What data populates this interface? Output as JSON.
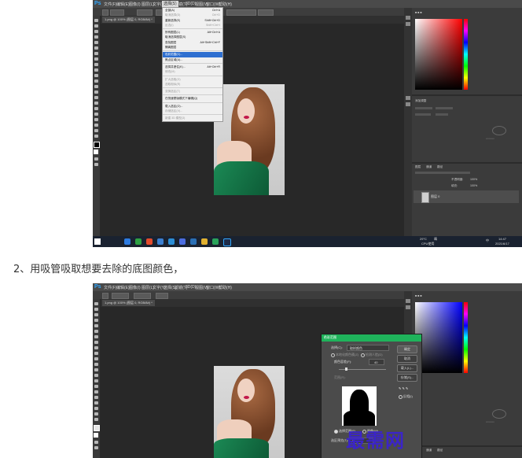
{
  "screenshot1": {
    "menu": [
      "文件(F)",
      "编辑(E)",
      "图像(I)",
      "图层(L)",
      "文字(Y)",
      "选择(S)",
      "滤镜(T)",
      "3D(D)",
      "视图(V)",
      "窗口(W)",
      "帮助(H)"
    ],
    "active_menu": "选择(S)",
    "doc_tab": "1.png @ 100% (图层 0, RGB/8#) *",
    "select_menu": [
      {
        "label": "全部(A)",
        "key": "Ctrl+A",
        "dim": false
      },
      {
        "label": "取消选择(D)",
        "key": "Ctrl+D",
        "dim": true
      },
      {
        "label": "重新选择(E)",
        "key": "Shift+Ctrl+D",
        "dim": false
      },
      {
        "label": "反选(I)",
        "key": "Shift+Ctrl+I",
        "dim": true
      },
      {
        "sep": true
      },
      {
        "label": "所有图层(L)",
        "key": "Alt+Ctrl+A",
        "dim": false
      },
      {
        "label": "取消选择图层(S)",
        "key": "",
        "dim": false
      },
      {
        "label": "查找图层",
        "key": "Alt+Shift+Ctrl+F",
        "dim": false
      },
      {
        "label": "隔离图层",
        "key": "",
        "dim": false
      },
      {
        "sep": true
      },
      {
        "label": "色彩范围(C)...",
        "key": "",
        "dim": false,
        "highlight": true
      },
      {
        "label": "焦点区域(U)...",
        "key": "",
        "dim": false
      },
      {
        "sep": true
      },
      {
        "label": "选择并遮住(K)...",
        "key": "Alt+Ctrl+R",
        "dim": false
      },
      {
        "label": "修改(M)",
        "key": "",
        "dim": true
      },
      {
        "sep": true
      },
      {
        "label": "扩大选取(G)",
        "key": "",
        "dim": true
      },
      {
        "label": "选取相似(R)",
        "key": "",
        "dim": true
      },
      {
        "sep": true
      },
      {
        "label": "变换选区(T)",
        "key": "",
        "dim": true
      },
      {
        "sep": true
      },
      {
        "label": "在快速蒙版模式下编辑(Q)",
        "key": "",
        "dim": false
      },
      {
        "sep": true
      },
      {
        "label": "载入选区(O)...",
        "key": "",
        "dim": false
      },
      {
        "label": "存储选区(V)...",
        "key": "",
        "dim": true
      },
      {
        "sep": true
      },
      {
        "label": "新建 3D 模型(3)",
        "key": "",
        "dim": true
      }
    ],
    "layers_tabs": [
      "图层",
      "通道",
      "路径"
    ],
    "layer_name": "图层 0",
    "panel_label": "添加调整",
    "opacity_label": "不透明度:",
    "opacity": "100%",
    "fill_label": "填充:",
    "fill": "100%",
    "taskbar_time": "14:47",
    "taskbar_date": "2021/6/17",
    "taskbar_temp": "29°C",
    "taskbar_cpu": "CPU使用",
    "taskbar_lang": "中",
    "taskbar_weather": "晴"
  },
  "caption": "2、用吸管吸取想要去除的底图颜色，",
  "screenshot2": {
    "doc_tab": "1.png @ 100% (图层 0, RGB/8#) *",
    "dialog": {
      "title": "色彩范围",
      "select_label": "选择(C):",
      "select_value": "取样颜色",
      "localized_label": "本地化颜色簇(Z)",
      "detect_faces_label": "检测人脸(D)",
      "fuzziness_label": "颜色容差(F):",
      "fuzziness_value": "40",
      "range_label": "范围(R):",
      "buttons": [
        "确定",
        "取消",
        "载入(L)...",
        "存储(S)..."
      ],
      "invert_label": "反相(I)",
      "radio_selection": "选择范围(E)",
      "radio_image": "图像(M)",
      "preview_label": "选区预览(T):",
      "preview_value": "无"
    },
    "watermark": "最需网"
  }
}
